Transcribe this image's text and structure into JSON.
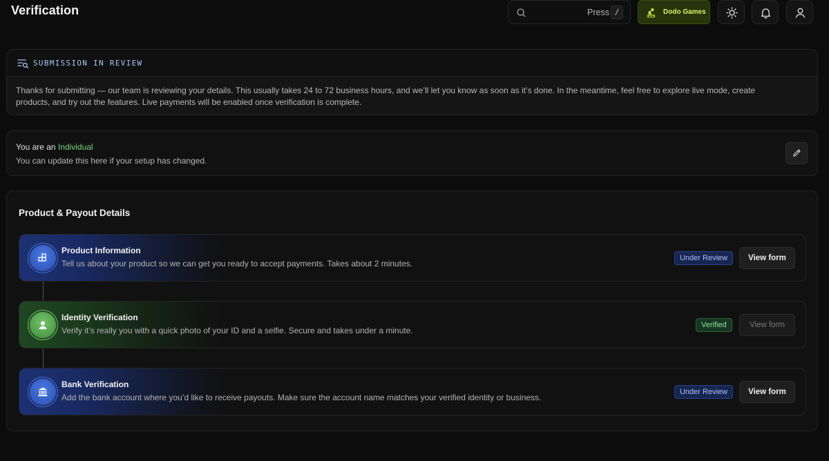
{
  "header": {
    "title": "Verification",
    "search": {
      "hint": "Press",
      "shortcut": "/"
    },
    "brand": {
      "name": "Dodo Games",
      "icon": "dodo-games-logo"
    },
    "icons": [
      "sun-icon",
      "bell-icon",
      "user-icon"
    ]
  },
  "review_notice": {
    "icon": "list-search-icon",
    "title": "SUBMISSION IN REVIEW",
    "body": "Thanks for submitting — our team is reviewing your details. This usually takes 24 to 72 business hours, and we’ll let you know as soon as it’s done. In the meantime, feel free to explore live mode, create products, and try out the features. Live payments will be enabled once verification is complete."
  },
  "entity": {
    "prefix": "You are an",
    "type": "Individual",
    "hint": "You can update this here if your setup has changed.",
    "edit_icon": "pencil-icon"
  },
  "details": {
    "title": "Product & Payout Details",
    "steps": [
      {
        "title": "Product Information",
        "description": "Tell us about your product so we can get you ready to accept payments. Takes about 2 minutes.",
        "status": "Under Review",
        "action": "View form",
        "icon": "product-icon"
      },
      {
        "title": "Identity Verification",
        "description": "Verify it’s really you with a quick photo of your ID and a selfie. Secure and takes under a minute.",
        "status": "Verified",
        "action": "View form",
        "icon": "person-icon"
      },
      {
        "title": "Bank Verification",
        "description": "Add the bank account where you’d like to receive payouts. Make sure the account name matches your verified identity or business.",
        "status": "Under Review",
        "action": "View form",
        "icon": "bank-icon"
      }
    ]
  },
  "colors": {
    "background": "#0c0c0c",
    "accent_blue": "#2a4fb0",
    "accent_green": "#3f8a3a",
    "brand_lime": "#d7f26a"
  }
}
